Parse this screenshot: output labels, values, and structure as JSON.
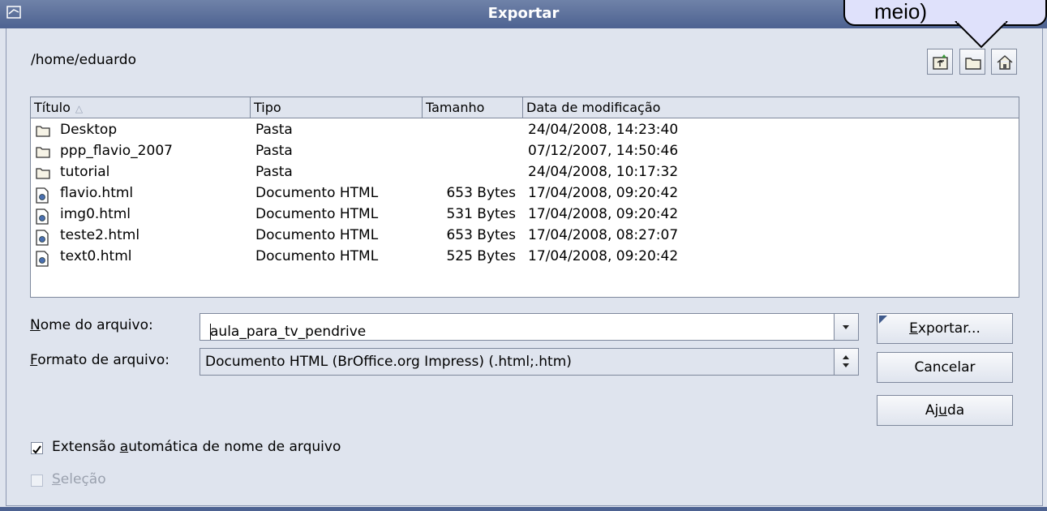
{
  "window": {
    "title": "Exportar"
  },
  "current_path": "/home/eduardo",
  "toolbar": {
    "icons": [
      "folder-up-icon",
      "new-folder-icon",
      "home-icon"
    ]
  },
  "file_list": {
    "columns": [
      "Título",
      "Tipo",
      "Tamanho",
      "Data de modificação"
    ],
    "rows": [
      {
        "name": "Desktop",
        "type": "Pasta",
        "size": "",
        "date": "24/04/2008, 14:23:40",
        "icon": "folder-icon"
      },
      {
        "name": "ppp_flavio_2007",
        "type": "Pasta",
        "size": "",
        "date": "07/12/2007, 14:50:46",
        "icon": "folder-icon"
      },
      {
        "name": "tutorial",
        "type": "Pasta",
        "size": "",
        "date": "24/04/2008, 10:17:32",
        "icon": "folder-icon"
      },
      {
        "name": "flavio.html",
        "type": "Documento HTML",
        "size": "653 Bytes",
        "date": "17/04/2008, 09:20:42",
        "icon": "html-file-icon"
      },
      {
        "name": "img0.html",
        "type": "Documento HTML",
        "size": "531 Bytes",
        "date": "17/04/2008, 09:20:42",
        "icon": "html-file-icon"
      },
      {
        "name": "teste2.html",
        "type": "Documento HTML",
        "size": "653 Bytes",
        "date": "17/04/2008, 08:27:07",
        "icon": "html-file-icon"
      },
      {
        "name": "text0.html",
        "type": "Documento HTML",
        "size": "525 Bytes",
        "date": "17/04/2008, 09:20:42",
        "icon": "html-file-icon"
      }
    ]
  },
  "form": {
    "filename_label": {
      "mnemonic": "N",
      "rest": "ome do arquivo:"
    },
    "filename_value": "aula_para_tv_pendrive",
    "format_label": {
      "mnemonic": "F",
      "rest": "ormato de arquivo:"
    },
    "format_value": "Documento HTML (BrOffice.org Impress) (.html;.htm)"
  },
  "buttons": {
    "export": {
      "mnemonic": "E",
      "rest": "xportar..."
    },
    "cancel": "Cancelar",
    "help": {
      "before": "Aj",
      "mnemonic": "u",
      "after": "da"
    }
  },
  "options": {
    "auto_extension": {
      "before": "Extensão ",
      "mnemonic": "a",
      "after": "utomática de nome de arquivo",
      "checked": true
    },
    "selection": {
      "mnemonic": "S",
      "rest": "eleção",
      "checked": false,
      "enabled": false
    }
  },
  "callout": {
    "text": "meio)"
  },
  "colors": {
    "titlebar": "#4d6291",
    "dialog_bg": "#dfe4ee",
    "callout_bg": "#dfe1fb"
  }
}
